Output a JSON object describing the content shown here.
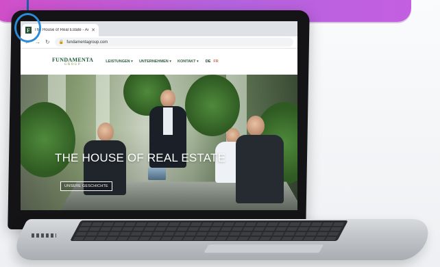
{
  "browser": {
    "tab_title": "The House of Real Estate - Acon",
    "tab_close_icon": "close-icon",
    "url": "fundamentagroup.com",
    "favicon_letter": "F"
  },
  "site": {
    "logo_main": "FUNDAMENTA",
    "logo_sub": "GROUP",
    "nav": [
      "LEISTUNGEN ▾",
      "UNTERNEHMEN ▾",
      "KONTAKT ▾"
    ],
    "languages": [
      "DE",
      "FR"
    ],
    "hero_title": "THE HOUSE OF REAL ESTATE",
    "hero_button": "UNSERE GESCHICHTE"
  },
  "colors": {
    "banner": "#c15bd9",
    "highlight": "#2c8ad6",
    "brand_green": "#235b3a"
  }
}
